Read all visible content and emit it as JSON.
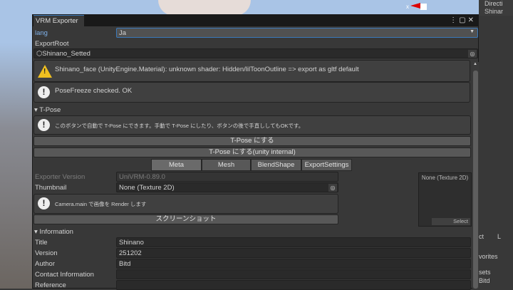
{
  "window": {
    "title": "VRM Exporter"
  },
  "lang": {
    "label": "lang",
    "value": "Ja"
  },
  "export_root": {
    "label": "ExportRoot",
    "value": "Shinano_Setted"
  },
  "messages": [
    {
      "type": "warning",
      "text": "Shinano_face (UnityEngine.Material): unknown shader: Hidden/lilToonOutline => export as gltf default"
    },
    {
      "type": "info",
      "text": "PoseFreeze checked. OK"
    }
  ],
  "tpose": {
    "header": "T-Pose",
    "help": "このボタンで自動で T-Pose にできます。手動で T-Pose にしたり、ボタンの後で手直ししてもOKです。",
    "button1": "T-Pose にする",
    "button2": "T-Pose にする(unity internal)"
  },
  "tabs": [
    {
      "label": "Meta",
      "active": true
    },
    {
      "label": "Mesh"
    },
    {
      "label": "BlendShape"
    },
    {
      "label": "ExportSettings"
    }
  ],
  "meta": {
    "exporter_version_label": "Exporter Version",
    "exporter_version": "UniVRM-0.89.0",
    "thumbnail_label": "Thumbnail",
    "thumbnail": "None (Texture 2D)",
    "camera_help": "Camera.main で画像を Render します",
    "screenshot_button": "スクリーンショット",
    "preview_label": "None (Texture 2D)",
    "preview_select": "Select"
  },
  "information": {
    "header": "Information",
    "fields": [
      {
        "label": "Title",
        "value": "Shinano"
      },
      {
        "label": "Version",
        "value": "251202"
      },
      {
        "label": "Author",
        "value": "Bitd"
      },
      {
        "label": "Contact Information",
        "value": ""
      },
      {
        "label": "Reference",
        "value": ""
      }
    ]
  },
  "hierarchy": [
    "Directi",
    "Shinar"
  ],
  "project": {
    "tab1": "ct",
    "tab2": "L",
    "items": [
      "vorites",
      "sets",
      "Bitd"
    ]
  }
}
